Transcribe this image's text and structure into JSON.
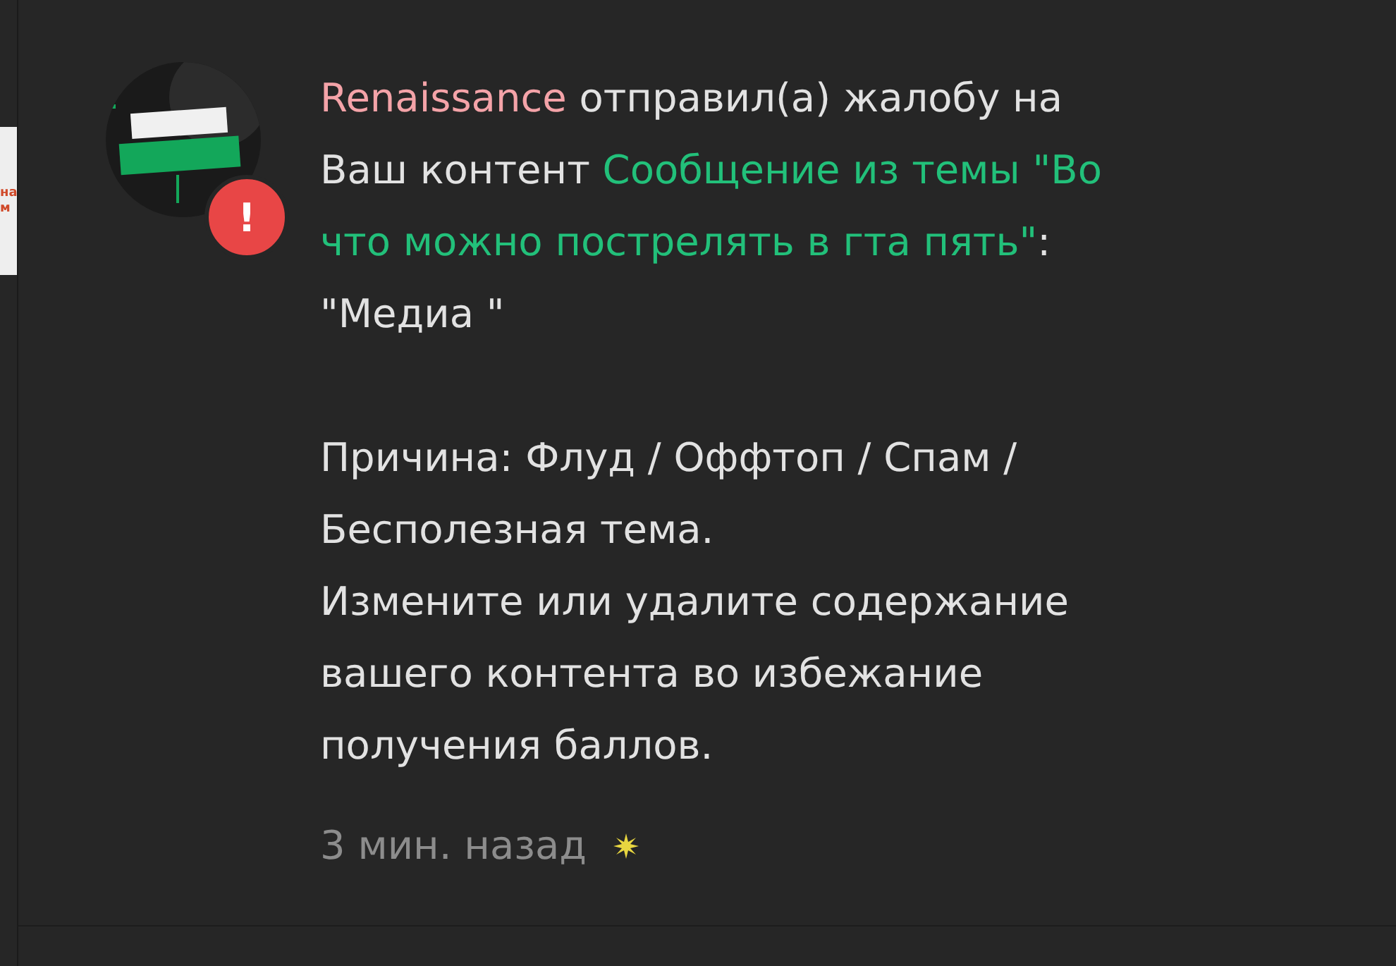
{
  "left_edge_card": {
    "lines": [
      "на",
      "м"
    ]
  },
  "notification": {
    "avatar": {
      "kind": "picture"
    },
    "badge": "!",
    "message_lines": [
      [
        {
          "kind": "author",
          "text": "Renaissance"
        },
        {
          "kind": "text",
          "text": " отправил(а) жалобу на"
        }
      ],
      [
        {
          "kind": "text",
          "text": "Ваш контент "
        },
        {
          "kind": "link",
          "text": "Сообщение из темы \"Во"
        }
      ],
      [
        {
          "kind": "link",
          "text": "что можно пострелять в гта пять\""
        },
        {
          "kind": "text",
          "text": ":"
        }
      ],
      [
        {
          "kind": "text",
          "text": "\"Медиа \""
        }
      ]
    ],
    "reason": "Причина: Флуд / Оффтоп / Спам / Бесполезная тема.",
    "instruction": "Измените или удалите содержание вашего контента во избежание получения баллов.",
    "time": "3 мин. назад"
  }
}
